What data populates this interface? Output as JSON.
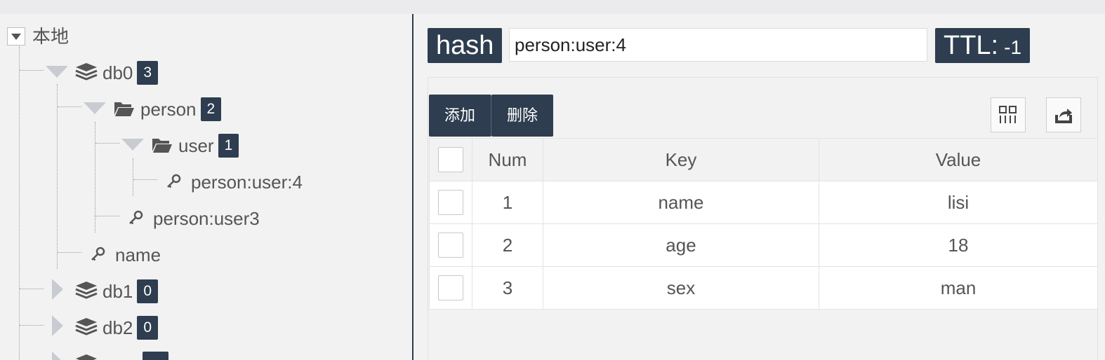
{
  "tree": {
    "root_label": "本地",
    "nodes": [
      {
        "label": "db0",
        "count": "3"
      },
      {
        "label": "person",
        "count": "2"
      },
      {
        "label": "user",
        "count": "1"
      },
      {
        "label": "person:user:4"
      },
      {
        "label": "person:user3"
      },
      {
        "label": "name"
      },
      {
        "label": "db1",
        "count": "0"
      },
      {
        "label": "db2",
        "count": "0"
      }
    ]
  },
  "detail": {
    "type": "hash",
    "key": "person:user:4",
    "ttl_label": "TTL:",
    "ttl_value": "-1"
  },
  "toolbar": {
    "add_label": "添加",
    "delete_label": "删除",
    "columns_icon": "columns-icon",
    "export_icon": "export-icon"
  },
  "table": {
    "headers": [
      "Num",
      "Key",
      "Value"
    ],
    "rows": [
      {
        "num": "1",
        "key": "name",
        "value": "lisi"
      },
      {
        "num": "2",
        "key": "age",
        "value": "18"
      },
      {
        "num": "3",
        "key": "sex",
        "value": "man"
      }
    ]
  },
  "colors": {
    "accent": "#2e3d4f",
    "background": "#f2f2f2"
  }
}
